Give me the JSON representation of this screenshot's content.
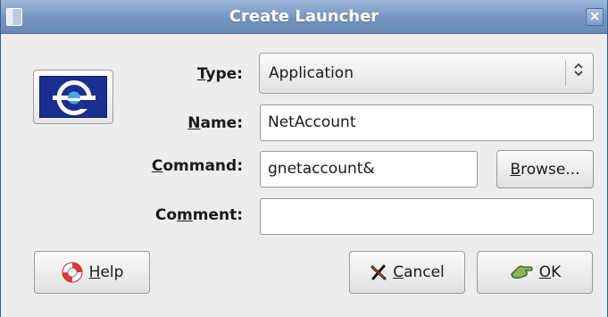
{
  "window": {
    "title": "Create Launcher",
    "close_glyph": "×"
  },
  "icon": {
    "name": "netaccount-app-icon",
    "letter": "e"
  },
  "form": {
    "type": {
      "label_u": "T",
      "label_rest": "ype:",
      "value": "Application"
    },
    "name": {
      "label_u": "N",
      "label_rest": "ame:",
      "value": "NetAccount"
    },
    "command": {
      "label_u": "C",
      "label_rest": "ommand:",
      "value": "gnetaccount&"
    },
    "comment": {
      "label_pre": "Co",
      "label_u": "m",
      "label_rest": "ment:",
      "value": ""
    }
  },
  "buttons": {
    "browse": {
      "label_u": "B",
      "label_rest": "rowse..."
    },
    "help": {
      "label_u": "H",
      "label_rest": "elp"
    },
    "cancel": {
      "label_u": "C",
      "label_rest": "ancel"
    },
    "ok": {
      "label_u": "O",
      "label_rest": "K"
    }
  },
  "colors": {
    "titlebar": "#7595c0",
    "app_icon_bg": "#1b2f8f",
    "cancel_icon": "#1a1a1a",
    "ok_icon": "#5a7f3a"
  }
}
